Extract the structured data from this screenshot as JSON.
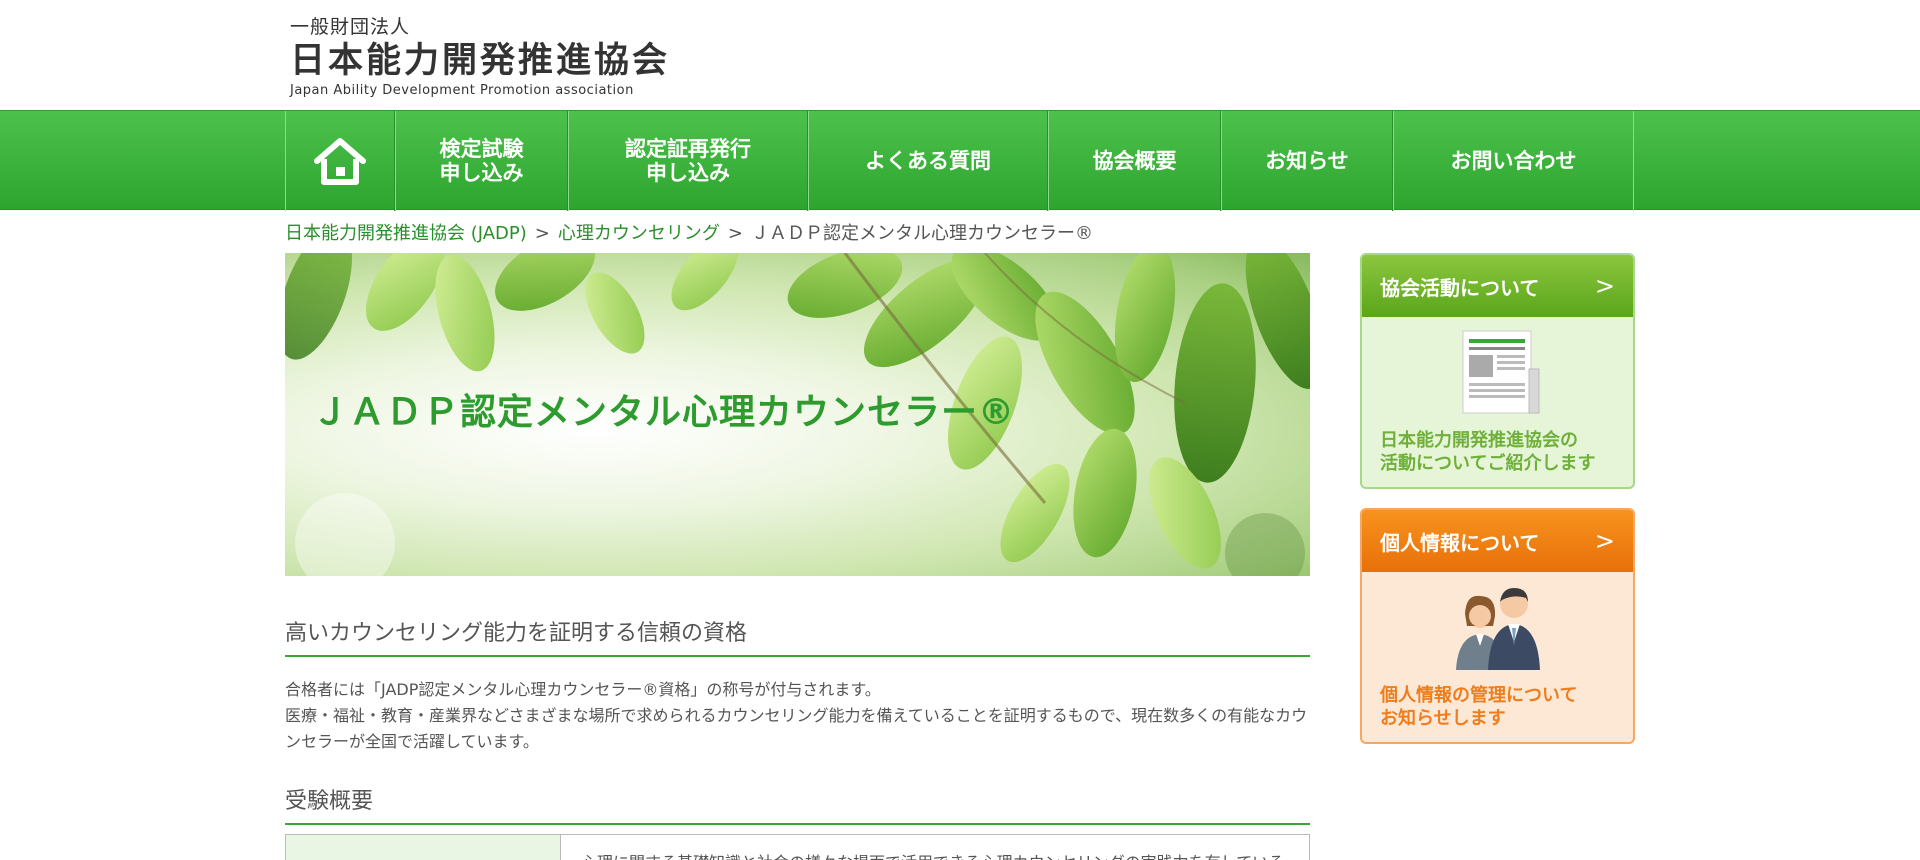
{
  "header": {
    "logo_sub": "一般財団法人",
    "logo_main": "日本能力開発推進協会",
    "logo_en": "Japan Ability Development Promotion association"
  },
  "nav": {
    "items": [
      {
        "label": "検定試験\n申し込み"
      },
      {
        "label": "認定証再発行\n申し込み"
      },
      {
        "label": "よくある質問"
      },
      {
        "label": "協会概要"
      },
      {
        "label": "お知らせ"
      },
      {
        "label": "お問い合わせ"
      }
    ]
  },
  "breadcrumb": {
    "items": [
      "日本能力開発推進協会 (JADP)",
      "心理カウンセリング",
      "ＪＡＤＰ認定メンタル心理カウンセラー®"
    ],
    "separator": ">"
  },
  "hero": {
    "title": "ＪＡＤＰ認定メンタル心理カウンセラー®"
  },
  "main": {
    "section1_heading": "高いカウンセリング能力を証明する信頼の資格",
    "section1_para1": "合格者には「JADP認定メンタル心理カウンセラー®資格」の称号が付与されます。",
    "section1_para2": "医療・福祉・教育・産業界などさまざまな場所で求められるカウンセリング能力を備えていることを証明するもので、現在数多くの有能なカウンセラーが全国で活躍しています。",
    "section2_heading": "受験概要",
    "table_cell": "心理に関する基礎知識と社会の様々な場面で活用できる心理カウンセリングの実践力を有していること"
  },
  "sidebar": {
    "banner1": {
      "title": "協会活動について",
      "chevron": ">",
      "text": "日本能力開発推進協会の\n活動についてご紹介します",
      "icon": "newsletter-icon"
    },
    "banner2": {
      "title": "個人情報について",
      "chevron": ">",
      "text": "個人情報の管理について\nお知らせします",
      "icon": "people-icon"
    }
  },
  "colors": {
    "brand_green": "#2e9b2e",
    "nav_green": "#3cb43c",
    "orange": "#f7931e"
  }
}
